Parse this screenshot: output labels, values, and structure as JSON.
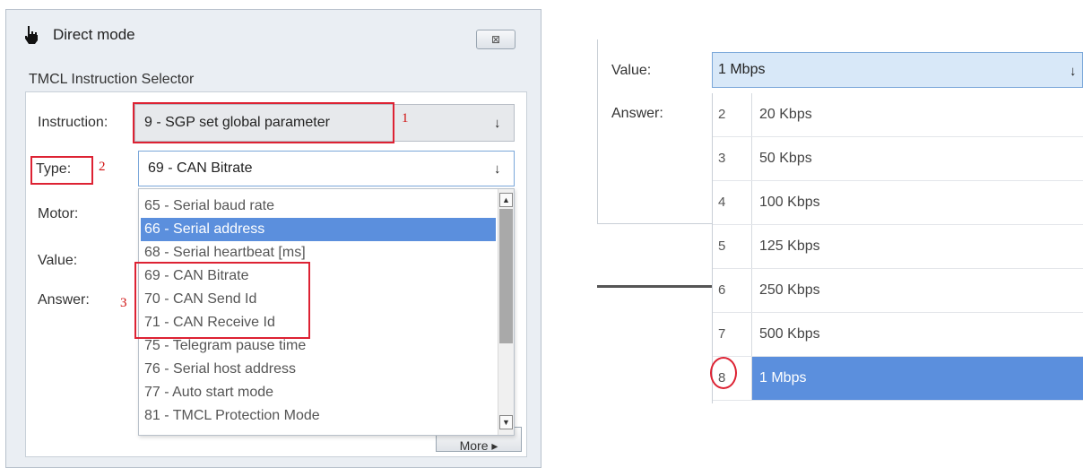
{
  "left": {
    "window_title": "Direct mode",
    "close_glyph": "⊠",
    "selector_label": "TMCL Instruction Selector",
    "labels": {
      "instruction": "Instruction:",
      "type": "Type:",
      "motor": "Motor:",
      "value": "Value:",
      "answer": "Answer:"
    },
    "instruction_value": "9 - SGP set global parameter",
    "type_value": "69 - CAN Bitrate",
    "dropdown_items": [
      "65 - Serial baud rate",
      "66 - Serial address",
      "68 - Serial heartbeat [ms]",
      "69 - CAN Bitrate",
      "70 - CAN Send Id",
      "71 - CAN Receive Id",
      "75 - Telegram pause time",
      "76 - Serial host address",
      "77 - Auto start mode",
      "81 - TMCL Protection Mode"
    ],
    "dropdown_selected": "66 - Serial address",
    "more_label": "More ▸",
    "annotations": {
      "n1": "1",
      "n2": "2",
      "n3": "3"
    }
  },
  "right": {
    "labels": {
      "value": "Value:",
      "answer": "Answer:"
    },
    "value_selected": "1 Mbps",
    "options": [
      {
        "num": "2",
        "label": "20 Kbps"
      },
      {
        "num": "3",
        "label": "50 Kbps"
      },
      {
        "num": "4",
        "label": "100 Kbps"
      },
      {
        "num": "5",
        "label": "125 Kbps"
      },
      {
        "num": "6",
        "label": "250 Kbps"
      },
      {
        "num": "7",
        "label": "500 Kbps"
      },
      {
        "num": "8",
        "label": "1 Mbps"
      }
    ],
    "selected_option": "1 Mbps"
  },
  "colors": {
    "selection": "#5b8fdd",
    "annotation_red": "#dd2233"
  },
  "icons": {
    "arrow": "down-arrow-icon",
    "hand": "hand-pointer-icon"
  }
}
